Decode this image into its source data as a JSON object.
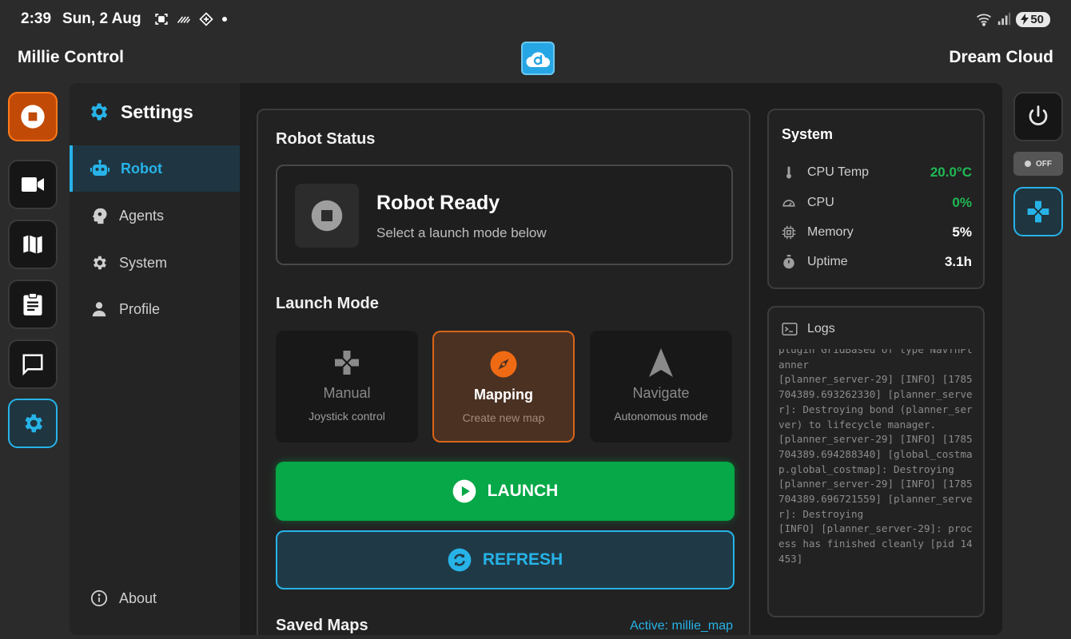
{
  "status_bar": {
    "time": "2:39",
    "date": "Sun, 2 Aug",
    "battery": "50"
  },
  "app": {
    "title": "Millie Control",
    "right_title": "Dream Cloud"
  },
  "left_rail": [
    {
      "icon": "stop-icon",
      "active": false
    },
    {
      "icon": "camera-icon",
      "active": false
    },
    {
      "icon": "map-icon",
      "active": false
    },
    {
      "icon": "clipboard-icon",
      "active": false
    },
    {
      "icon": "chat-icon",
      "active": false
    },
    {
      "icon": "gear-icon",
      "active": true
    }
  ],
  "sidebar": {
    "title": "Settings",
    "items": [
      {
        "label": "Robot",
        "icon": "robot-icon",
        "selected": true
      },
      {
        "label": "Agents",
        "icon": "head-icon",
        "selected": false
      },
      {
        "label": "System",
        "icon": "gear-icon",
        "selected": false
      },
      {
        "label": "Profile",
        "icon": "person-icon",
        "selected": false
      }
    ],
    "about": "About"
  },
  "robot_status": {
    "title": "Robot Status",
    "state": "Robot Ready",
    "hint": "Select a launch mode below"
  },
  "launch_mode": {
    "title": "Launch Mode",
    "modes": [
      {
        "name": "Manual",
        "desc": "Joystick control",
        "selected": false
      },
      {
        "name": "Mapping",
        "desc": "Create new map",
        "selected": true
      },
      {
        "name": "Navigate",
        "desc": "Autonomous mode",
        "selected": false
      }
    ],
    "launch_label": "LAUNCH",
    "refresh_label": "REFRESH"
  },
  "saved_maps": {
    "title": "Saved Maps",
    "active": "Active: millie_map"
  },
  "system": {
    "title": "System",
    "rows": [
      {
        "label": "CPU Temp",
        "value": "20.0°C",
        "color": "#1fb954"
      },
      {
        "label": "CPU",
        "value": "0%",
        "color": "#1fb954"
      },
      {
        "label": "Memory",
        "value": "5%",
        "color": "#ffffff"
      },
      {
        "label": "Uptime",
        "value": "3.1h",
        "color": "#ffffff"
      }
    ]
  },
  "logs": {
    "title": "Logs",
    "text": "plugin GridBased of type NavfnPlanner\n[planner_server-29] [INFO] [1785704389.693262330] [planner_server]: Destroying bond (planner_server) to lifecycle manager.\n[planner_server-29] [INFO] [1785704389.694288340] [global_costmap.global_costmap]: Destroying\n[planner_server-29] [INFO] [1785704389.696721559] [planner_server]: Destroying\n[INFO] [planner_server-29]: process has finished cleanly [pid 14453]"
  },
  "right_rail": {
    "toggle_label": "OFF"
  },
  "colors": {
    "accent": "#27b3e8",
    "stop": "#c14a06",
    "launch": "#06a847",
    "mapping": "#d8651a"
  }
}
